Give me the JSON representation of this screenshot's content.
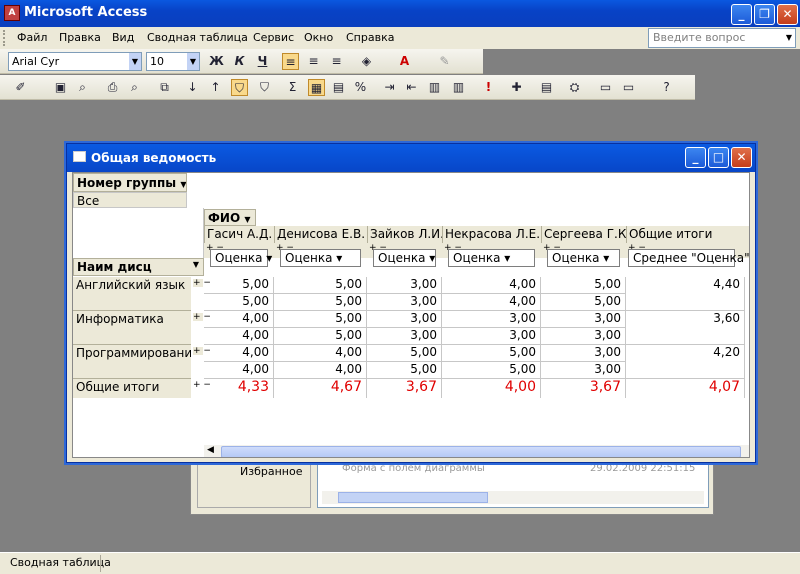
{
  "app": {
    "title": "Microsoft Access"
  },
  "menu": [
    "Файл",
    "Правка",
    "Вид",
    "Сводная таблица",
    "Сервис",
    "Окно",
    "Справка"
  ],
  "ask": {
    "placeholder": "Введите вопрос"
  },
  "format": {
    "font": "Arial Cyr",
    "size": "10"
  },
  "status": {
    "text": "Сводная таблица"
  },
  "bgwin": {
    "item": "Избранное",
    "row": "Форма с полем диаграммы",
    "date": "29.02.2009 22:51:15"
  },
  "child": {
    "title": "Общая ведомость"
  },
  "pivot": {
    "filter_label": "Номер группы",
    "filter_value": "Все",
    "column_field": "ФИО",
    "row_field": "Наим дисц",
    "data_field": "Оценка",
    "avg_header": "Среднее \"Оценка\"",
    "columns": [
      "Гасич А.Д.",
      "Денисова Е.В.",
      "Зайков Л.И.",
      "Некрасова Л.Е.",
      "Сергеева Г.К.",
      "Общие итоги"
    ],
    "rows": [
      {
        "label": "Английский язык",
        "lines": [
          [
            "5,00",
            "5,00",
            "3,00",
            "4,00",
            "5,00"
          ],
          [
            "5,00",
            "5,00",
            "3,00",
            "4,00",
            "5,00"
          ]
        ],
        "avg": "4,40"
      },
      {
        "label": "Информатика",
        "lines": [
          [
            "4,00",
            "5,00",
            "3,00",
            "3,00",
            "3,00"
          ],
          [
            "4,00",
            "5,00",
            "3,00",
            "3,00",
            "3,00"
          ]
        ],
        "avg": "3,60"
      },
      {
        "label": "Программирование",
        "lines": [
          [
            "4,00",
            "4,00",
            "5,00",
            "5,00",
            "3,00"
          ],
          [
            "4,00",
            "4,00",
            "5,00",
            "5,00",
            "3,00"
          ]
        ],
        "avg": "4,20"
      }
    ],
    "totals_label": "Общие итоги",
    "totals": [
      "4,33",
      "4,67",
      "3,67",
      "4,00",
      "3,67",
      "4,07"
    ]
  }
}
